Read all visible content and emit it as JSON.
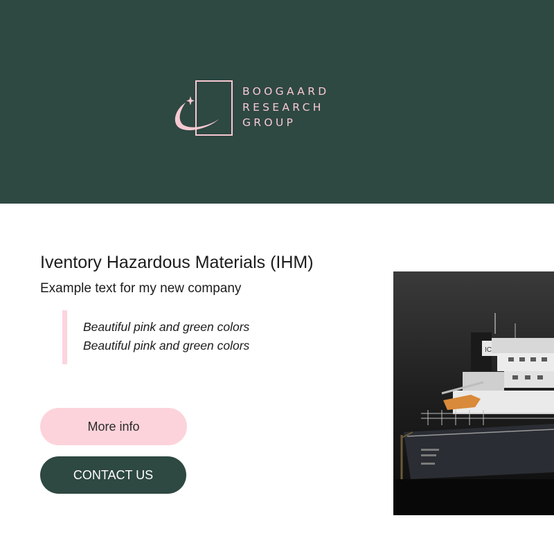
{
  "brand": {
    "logo_lines": [
      "BOOGAARD",
      "RESEARCH",
      "GROUP"
    ],
    "header_color": "#2e4842",
    "accent_color": "#f6c9d2"
  },
  "content": {
    "title": "Iventory Hazardous Materials (IHM)",
    "subtitle": "Example text for my new company",
    "quote_lines": [
      "Beautiful pink and green colors",
      "Beautiful pink and green colors"
    ]
  },
  "buttons": {
    "more_info": "More info",
    "contact": "CONTACT US"
  },
  "image": {
    "ship_marking": "ICL"
  }
}
